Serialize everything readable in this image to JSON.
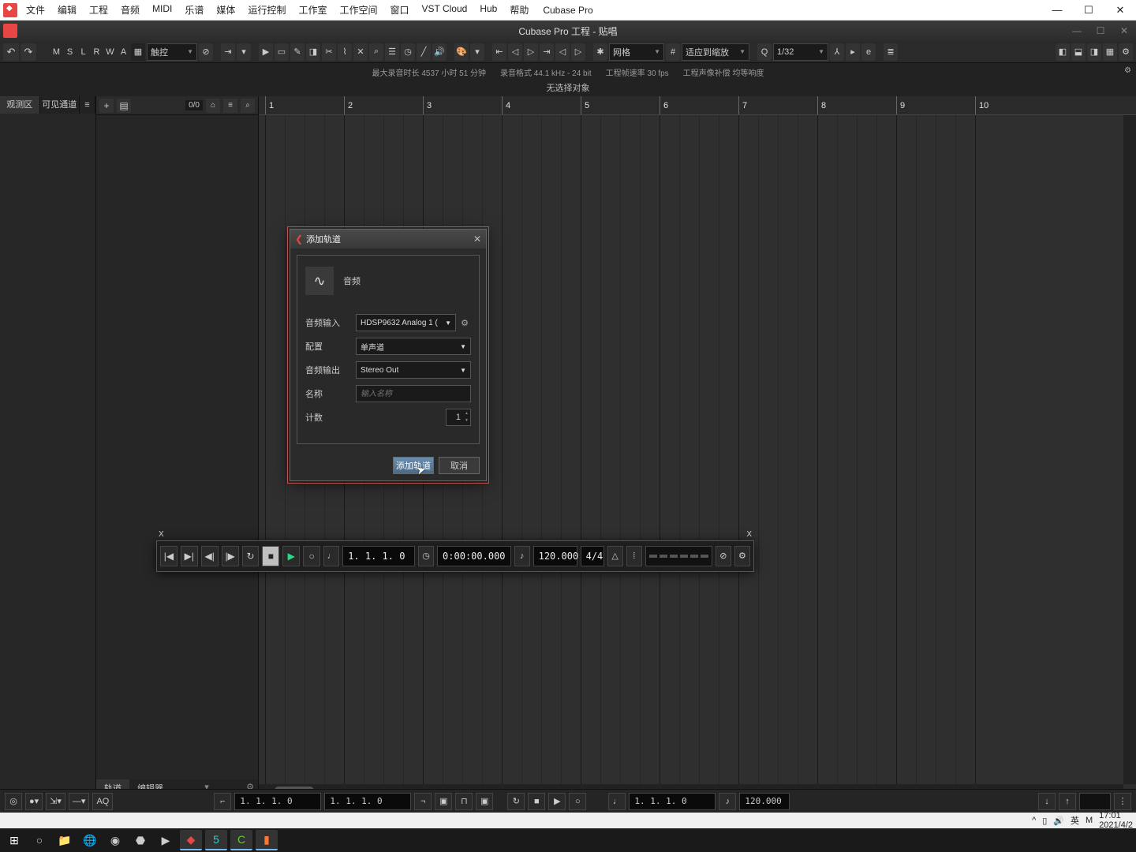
{
  "app": {
    "title": "Cubase Pro",
    "sub_title": "Cubase Pro 工程 - 贴唱"
  },
  "menu": [
    "文件",
    "编辑",
    "工程",
    "音频",
    "MIDI",
    "乐谱",
    "媒体",
    "运行控制",
    "工作室",
    "工作空间",
    "窗口",
    "VST Cloud",
    "Hub",
    "帮助"
  ],
  "toolbar": {
    "state_letters": [
      "M",
      "S",
      "L",
      "R",
      "W",
      "A"
    ],
    "automation_mode": "触控",
    "snap": "网格",
    "adapt": "适应到缩放",
    "quantize": "1/32"
  },
  "info": {
    "max_rec": "最大录音时长  4537 小时 51 分钟",
    "format": "录音格式  44.1 kHz - 24 bit",
    "fps": "工程帧速率  30 fps",
    "pan": "工程声像补偿  均等响度",
    "no_selection": "无选择对象"
  },
  "inspector": {
    "tabs": [
      "观测区",
      "可见通道"
    ],
    "lines_icon": "≡"
  },
  "tracklist": {
    "count": "0/0",
    "tabs": [
      "轨道",
      "编辑器"
    ]
  },
  "ruler": [
    1,
    2,
    3,
    4,
    5,
    6,
    7,
    8,
    9,
    10
  ],
  "dialog": {
    "title": "添加轨道",
    "type_label": "音频",
    "rows": {
      "input": {
        "label": "音频输入",
        "value": "HDSP9632 Analog 1 ("
      },
      "config": {
        "label": "配置",
        "value": "单声道"
      },
      "output": {
        "label": "音频输出",
        "value": "Stereo Out"
      },
      "name": {
        "label": "名称",
        "placeholder": "输入名称"
      },
      "count": {
        "label": "计数",
        "value": "1"
      }
    },
    "ok": "添加轨道",
    "cancel": "取消"
  },
  "transport": {
    "pos_bars": "1. 1. 1.  0",
    "pos_time": "0:00:00.000",
    "tempo": "120.000",
    "sig": "4/4"
  },
  "bottom": {
    "aq": "AQ",
    "loc1": "1. 1. 1.  0",
    "loc2": "1. 1. 1.  0",
    "pos": "1. 1. 1.  0",
    "tempo": "120.000"
  },
  "tray": {
    "ime": "英",
    "brand": "M",
    "time": "17:01",
    "date": "2021/4/2"
  }
}
